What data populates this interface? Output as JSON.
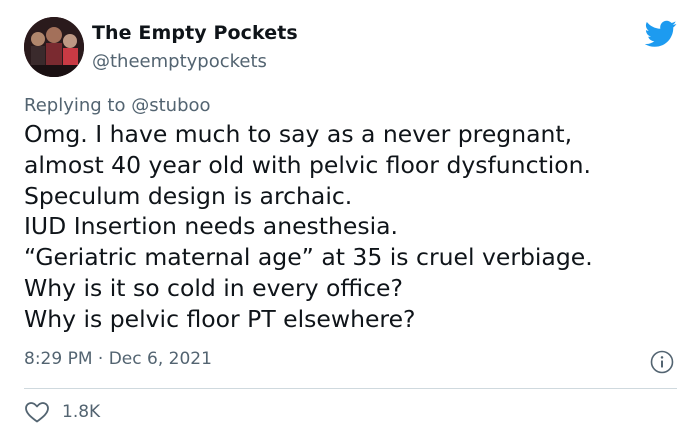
{
  "author": {
    "display_name": "The Empty Pockets",
    "handle": "@theemptypockets",
    "avatar_icon": "band-photo-avatar"
  },
  "brand": {
    "icon": "twitter-bird-icon",
    "color": "#1d9bf0"
  },
  "reply": {
    "prefix": "Replying to",
    "mention": "@stuboo"
  },
  "tweet": {
    "lines": [
      "Omg. I have much to say as a never pregnant,",
      "almost 40 year old with pelvic floor dysfunction.",
      "Speculum design is archaic.",
      "IUD Insertion needs anesthesia.",
      "“Geriatric maternal age” at 35 is cruel verbiage.",
      "Why is it so cold in every office?",
      "Why is pelvic floor PT elsewhere?"
    ]
  },
  "meta": {
    "time": "8:29 PM",
    "separator": "·",
    "date": "Dec 6, 2021",
    "info_icon": "info-icon"
  },
  "engagement": {
    "like_icon": "heart-icon",
    "likes": "1.8K"
  },
  "colors": {
    "text": "#0f1419",
    "secondary": "#536471",
    "divider": "#cfd9de"
  }
}
